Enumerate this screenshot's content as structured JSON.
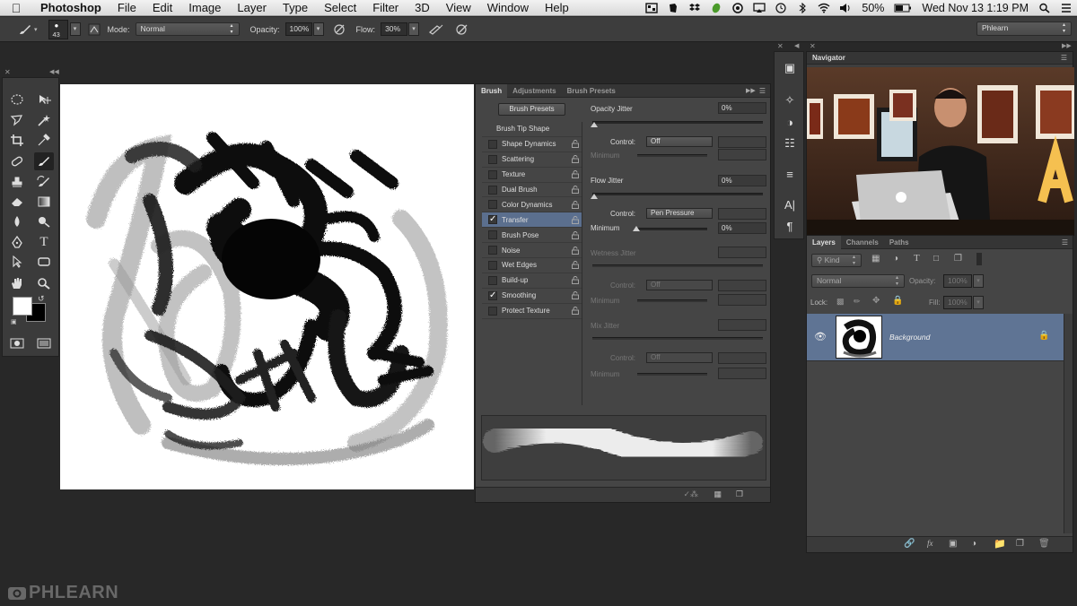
{
  "menubar": {
    "app_name": "Photoshop",
    "menus": [
      "File",
      "Edit",
      "Image",
      "Layer",
      "Type",
      "Select",
      "Filter",
      "3D",
      "View",
      "Window",
      "Help"
    ],
    "battery": "50%",
    "datetime": "Wed Nov 13  1:19 PM"
  },
  "options_bar": {
    "brush_size": "43",
    "mode_label": "Mode:",
    "mode_value": "Normal",
    "opacity_label": "Opacity:",
    "opacity_value": "100%",
    "flow_label": "Flow:",
    "flow_value": "30%",
    "workspace": "Phlearn"
  },
  "brush_panel": {
    "tabs": [
      "Brush",
      "Adjustments",
      "Brush Presets"
    ],
    "presets_button": "Brush Presets",
    "tip_shape": "Brush Tip Shape",
    "options": [
      {
        "label": "Shape Dynamics",
        "checked": false,
        "selected": false
      },
      {
        "label": "Scattering",
        "checked": false,
        "selected": false
      },
      {
        "label": "Texture",
        "checked": false,
        "selected": false
      },
      {
        "label": "Dual Brush",
        "checked": false,
        "selected": false
      },
      {
        "label": "Color Dynamics",
        "checked": false,
        "selected": false
      },
      {
        "label": "Transfer",
        "checked": true,
        "selected": true
      },
      {
        "label": "Brush Pose",
        "checked": false,
        "selected": false
      },
      {
        "label": "Noise",
        "checked": false,
        "selected": false
      },
      {
        "label": "Wet Edges",
        "checked": false,
        "selected": false
      },
      {
        "label": "Build-up",
        "checked": false,
        "selected": false
      },
      {
        "label": "Smoothing",
        "checked": true,
        "selected": false
      },
      {
        "label": "Protect Texture",
        "checked": false,
        "selected": false
      }
    ],
    "opacity_jitter": {
      "label": "Opacity Jitter",
      "value": "0%",
      "control_label": "Control:",
      "control": "Off",
      "minimum_label": "Minimum"
    },
    "flow_jitter": {
      "label": "Flow Jitter",
      "value": "0%",
      "control_label": "Control:",
      "control": "Pen Pressure",
      "minimum_label": "Minimum",
      "minimum_value": "0%"
    },
    "wetness_jitter": {
      "label": "Wetness Jitter",
      "control_label": "Control:",
      "control": "Off",
      "minimum_label": "Minimum"
    },
    "mix_jitter": {
      "label": "Mix Jitter",
      "control_label": "Control:",
      "control": "Off",
      "minimum_label": "Minimum"
    }
  },
  "navigator": {
    "title": "Navigator"
  },
  "layers_panel": {
    "tabs": [
      "Layers",
      "Channels",
      "Paths"
    ],
    "kind_label": "Kind",
    "blend_mode": "Normal",
    "opacity_label": "Opacity:",
    "opacity_value": "100%",
    "lock_label": "Lock:",
    "fill_label": "Fill:",
    "fill_value": "100%",
    "layers": [
      {
        "name": "Background",
        "visible": true,
        "locked": true
      }
    ]
  },
  "watermark": "PHLEARN",
  "colors": {
    "selection": "#5b6f8e",
    "layer_selected": "#5f7494",
    "panel": "#454545"
  }
}
